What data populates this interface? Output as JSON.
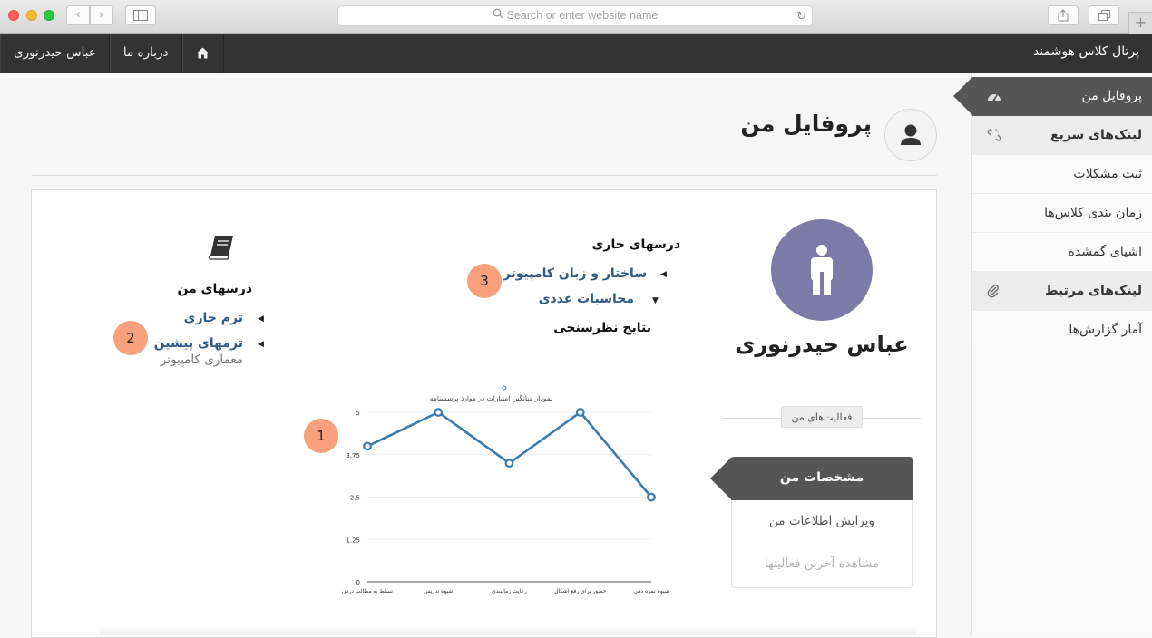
{
  "browser": {
    "url_placeholder": "Search or enter website name"
  },
  "topbar": {
    "brand": "پرتال کلاس هوشمند",
    "nav": [
      "عباس حیدرنوری",
      "درباره ما"
    ],
    "home_icon": "home-icon"
  },
  "sidebar": {
    "items": [
      {
        "label": "پروفایل من",
        "icon": "dashboard-icon",
        "active": true
      },
      {
        "label": "لینک‌های سریع",
        "icon": "unlink-icon",
        "header": true
      },
      {
        "label": "ثبت مشکلات"
      },
      {
        "label": "زمان بندی کلاس‌ها"
      },
      {
        "label": "اشیای گمشده"
      },
      {
        "label": "لینک‌های مرتبط",
        "icon": "paperclip-icon",
        "header": true
      },
      {
        "label": "آمار گزارش‌ها"
      }
    ]
  },
  "page": {
    "title": "پروفایل من"
  },
  "profile": {
    "name": "عباس حیدرنوری",
    "activities_button": "فعالیت‌های من",
    "menu": {
      "header": "مشخصات من",
      "items": [
        "ویرایش اطلاعات من",
        "مشاهده آخرین فعالیتها"
      ]
    }
  },
  "current_courses": {
    "title": "درسهای جاری",
    "items": [
      "ساختار و زبان کامپیوتر",
      "محاسبات عددی"
    ],
    "survey_title": "نتایج نظرسنجی"
  },
  "my_courses": {
    "title": "درسهای من",
    "items": [
      "ترم جاری",
      "ترمهای پیشین"
    ],
    "subitem": "معماری کامپیوتر"
  },
  "badges": [
    "1",
    "2",
    "3"
  ],
  "colors": {
    "badge": "#f7a07b",
    "link": "#2d5a87",
    "avatar": "#7e7aa8",
    "dark": "#333333",
    "line": "#3a7aad"
  },
  "chart_data": {
    "type": "line",
    "title": "نمودار میانگین امتیازات در موارد پرسشنامه",
    "categories": [
      "تسلط به مطالب درس",
      "شیوه تدریس",
      "رعایت زمانبندی",
      "حضور برای رفع اشکال",
      "شیوه نمره دهی"
    ],
    "values": [
      4,
      5,
      3.5,
      5,
      2.5
    ],
    "ylim": [
      0,
      5
    ],
    "yticks": [
      "0",
      "1.25",
      "2.5",
      "3.75",
      "5"
    ],
    "grid": true
  }
}
